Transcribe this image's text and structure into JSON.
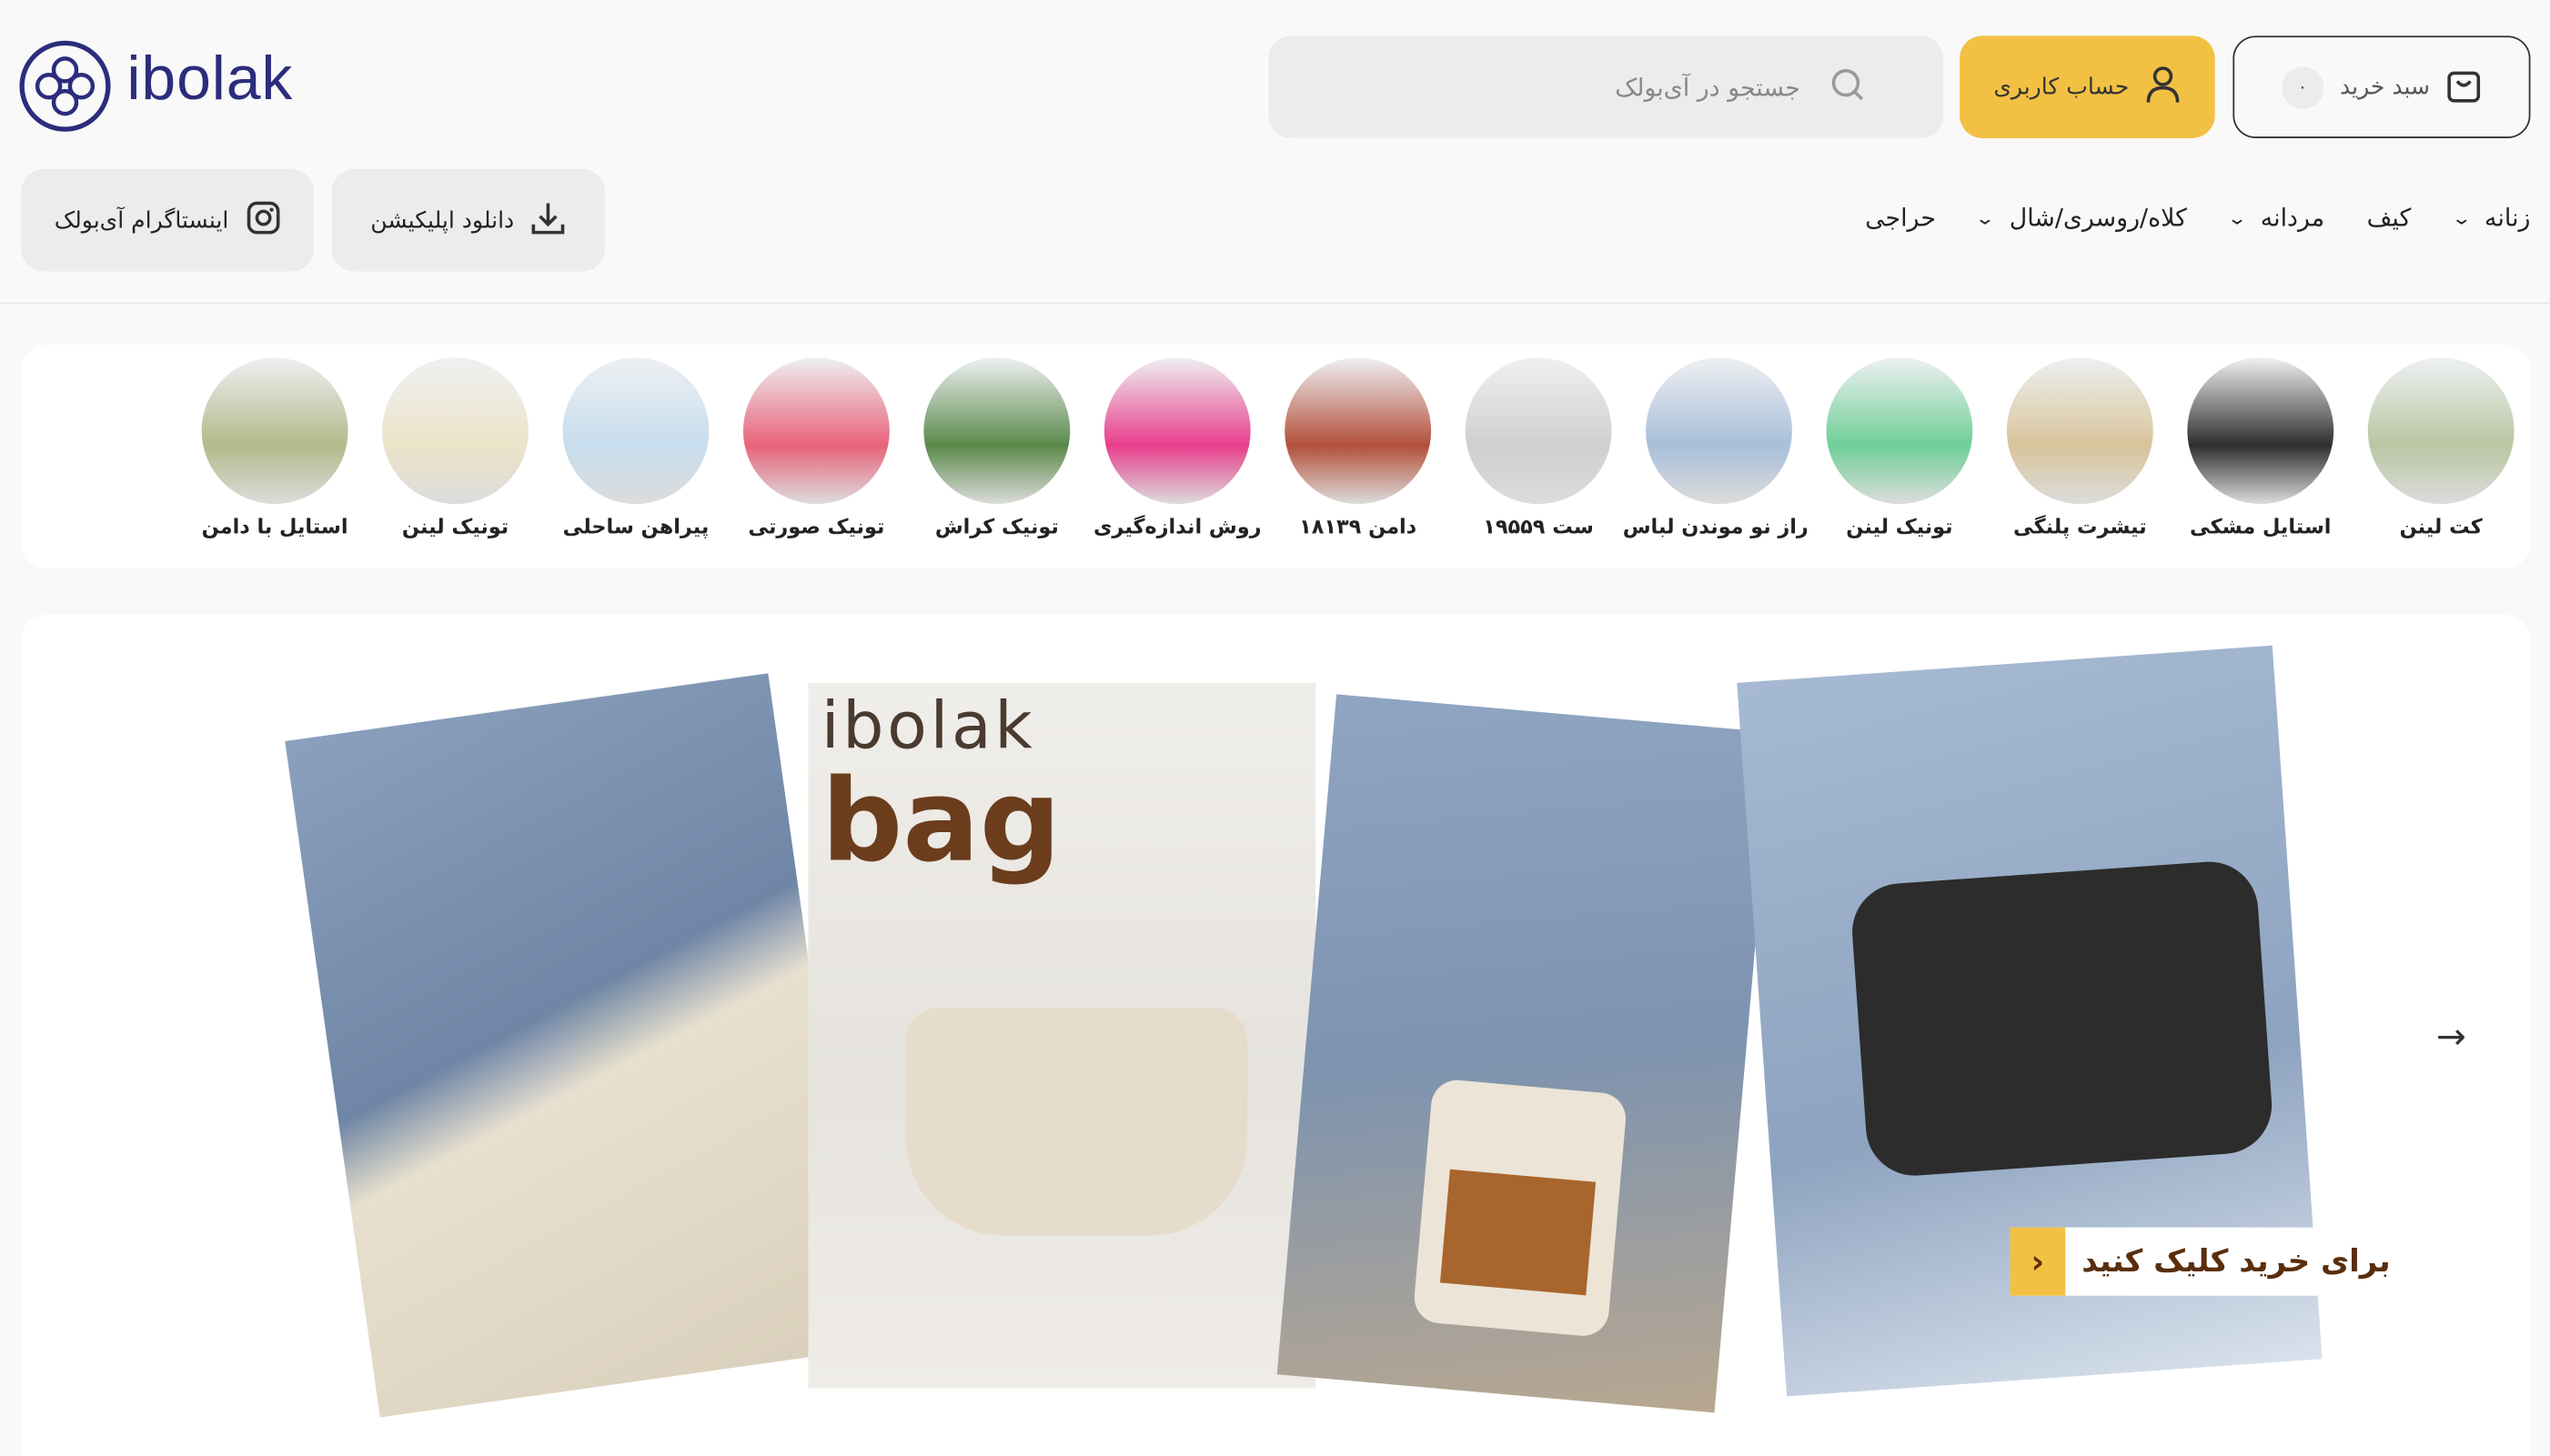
{
  "brand": {
    "name": "ibolak"
  },
  "header": {
    "cart": {
      "label": "سبد خرید",
      "count": "۰"
    },
    "account": {
      "label": "حساب کاربری"
    },
    "search": {
      "placeholder": "جستجو در آی‌بولک"
    }
  },
  "nav": {
    "items": [
      {
        "label": "زنانه",
        "dropdown": true
      },
      {
        "label": "کیف",
        "dropdown": false
      },
      {
        "label": "مردانه",
        "dropdown": true
      },
      {
        "label": "کلاه/روسری/شال",
        "dropdown": true
      },
      {
        "label": "حراجی",
        "dropdown": false
      }
    ],
    "download_app": "دانلود اپلیکیشن",
    "instagram": "اینستاگرام آی‌بولک"
  },
  "stories": [
    {
      "label": "کت لینن",
      "color": "#b9c6a2"
    },
    {
      "label": "استایل مشکی",
      "color": "#2e2e2e"
    },
    {
      "label": "تیشرت پلنگی",
      "color": "#d8c49a"
    },
    {
      "label": "تونیک لینن",
      "color": "#6fcf97"
    },
    {
      "label": "راز نو موندن لباس",
      "color": "#a8bfd9"
    },
    {
      "label": "ست ۱۹۵۵۹",
      "color": "#cfcfcf"
    },
    {
      "label": "دامن ۱۸۱۳۹",
      "color": "#b3503a"
    },
    {
      "label": "روش اندازه‌گیری",
      "color": "#e83e8c"
    },
    {
      "label": "تونیک کراش",
      "color": "#5a8a4a"
    },
    {
      "label": "تونیک صورتی",
      "color": "#e8637a"
    },
    {
      "label": "پیراهن ساحلی",
      "color": "#c7ddee"
    },
    {
      "label": "تونیک لینن",
      "color": "#ece3c8"
    },
    {
      "label": "استایل با دامن",
      "color": "#b4b98a"
    }
  ],
  "banner": {
    "photo_text_brand": "ibolak",
    "photo_text_word": "bag",
    "cta": "برای خرید کلیک کنید",
    "colors": {
      "denim": "#7d93b0",
      "rope": "#e8e0cf",
      "cream": "#ece6dc",
      "black_bag": "#2c2c2c",
      "brown": "#8b4b1f"
    }
  }
}
